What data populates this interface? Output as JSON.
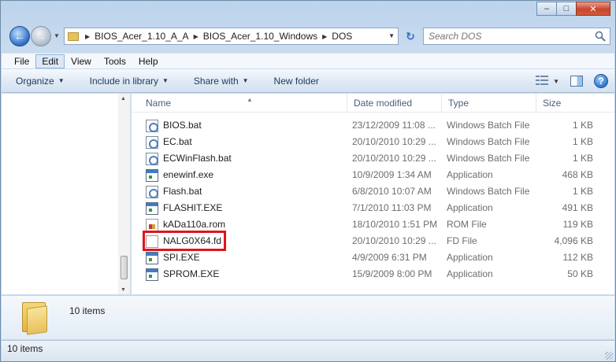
{
  "window": {
    "caption_buttons": [
      "minimize-icon",
      "maximize-icon",
      "close-icon"
    ]
  },
  "nav": {
    "breadcrumbs": [
      "BIOS_Acer_1.10_A_A",
      "BIOS_Acer_1.10_Windows",
      "DOS"
    ],
    "search_placeholder": "Search DOS"
  },
  "menu": [
    "File",
    "Edit",
    "View",
    "Tools",
    "Help"
  ],
  "menu_active": "Edit",
  "commands": [
    "Organize",
    "Include in library",
    "Share with",
    "New folder"
  ],
  "columns": {
    "name": "Name",
    "date": "Date modified",
    "type": "Type",
    "size": "Size"
  },
  "files": [
    {
      "name": "BIOS.bat",
      "date": "23/12/2009 11:08 ...",
      "type": "Windows Batch File",
      "size": "1 KB",
      "icon": "bat"
    },
    {
      "name": "EC.bat",
      "date": "20/10/2010 10:29 ...",
      "type": "Windows Batch File",
      "size": "1 KB",
      "icon": "bat"
    },
    {
      "name": "ECWinFlash.bat",
      "date": "20/10/2010 10:29 ...",
      "type": "Windows Batch File",
      "size": "1 KB",
      "icon": "bat"
    },
    {
      "name": "enewinf.exe",
      "date": "10/9/2009 1:34 AM",
      "type": "Application",
      "size": "468 KB",
      "icon": "exe"
    },
    {
      "name": "Flash.bat",
      "date": "6/8/2010 10:07 AM",
      "type": "Windows Batch File",
      "size": "1 KB",
      "icon": "bat"
    },
    {
      "name": "FLASHIT.EXE",
      "date": "7/1/2010 11:03 PM",
      "type": "Application",
      "size": "491 KB",
      "icon": "exe"
    },
    {
      "name": "kADa110a.rom",
      "date": "18/10/2010 1:51 PM",
      "type": "ROM File",
      "size": "119 KB",
      "icon": "rom"
    },
    {
      "name": "NALG0X64.fd",
      "date": "20/10/2010 10:29 ...",
      "type": "FD File",
      "size": "4,096 KB",
      "icon": "fd",
      "highlighted": true
    },
    {
      "name": "SPI.EXE",
      "date": "4/9/2009 6:31 PM",
      "type": "Application",
      "size": "112 KB",
      "icon": "exe"
    },
    {
      "name": "SPROM.EXE",
      "date": "15/9/2009 8:00 PM",
      "type": "Application",
      "size": "50 KB",
      "icon": "exe"
    }
  ],
  "details": {
    "item_count": "10 items"
  },
  "status": {
    "text": "10 items"
  },
  "colors": {
    "highlight": "#e0141b",
    "accent": "#2e6cc7"
  }
}
